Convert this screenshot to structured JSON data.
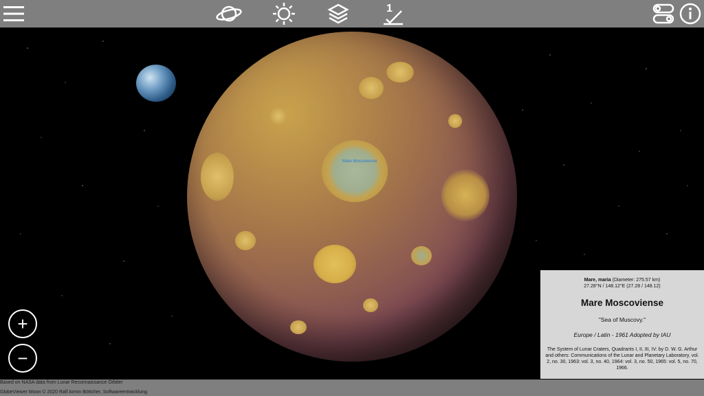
{
  "toolbar": {
    "menu_icon": "hamburger-menu-icon",
    "globe_icon": "planet-ring-icon",
    "light_icon": "sun-icon",
    "layers_icon": "layers-icon",
    "measure_icon": "distance-measure-icon",
    "measure_label": "1",
    "settings_icon": "toggle-switches-icon",
    "info_icon": "info-icon"
  },
  "map": {
    "marker_label": "Mare Moscoviense"
  },
  "zoom": {
    "in_label": "+",
    "out_label": "−"
  },
  "info_panel": {
    "type": "Mare, maria",
    "diameter": "(Diameter: 275.57 km)",
    "coords": "27.28°N / 148.12°E (27.28 / 148.12)",
    "name": "Mare Moscoviense",
    "meaning": "\"Sea of Muscovy.\"",
    "origin": "Europe / Latin - 1961 Adopted by IAU",
    "reference": "The System of Lunar Craters, Quadrants I, II, III, IV: by D. W. G. Arthur and others: Communications of the Lunar and Planetary Laboratory, vol. 2, no. 30, 1963: vol. 3, no. 40, 1964: vol. 3, no. 50, 1965: vol. 5, no. 70, 1966."
  },
  "footer": {
    "line1": "Based on NASA data from Lunar Reconnaissance Orbiter",
    "line2": "GlobeViewer Moon © 2020 Ralf Armin Böttcher, Softwareentwicklung"
  },
  "colors": {
    "toolbar_bg": "#7f7f7f",
    "panel_bg": "#d7d7d7",
    "marker": "#2a7bd6"
  }
}
